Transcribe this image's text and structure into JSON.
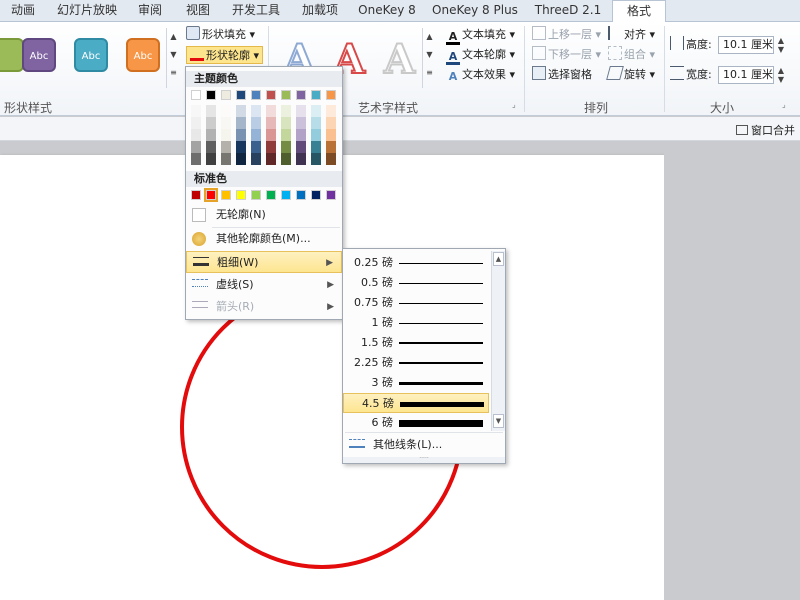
{
  "tabs": [
    {
      "label": "动画"
    },
    {
      "label": "幻灯片放映"
    },
    {
      "label": "审阅"
    },
    {
      "label": "视图"
    },
    {
      "label": "开发工具"
    },
    {
      "label": "加载项"
    },
    {
      "label": "OneKey 8"
    },
    {
      "label": "OneKey 8 Plus"
    },
    {
      "label": "ThreeD 2.1"
    },
    {
      "label": "格式"
    }
  ],
  "ribbon": {
    "shape_styles": {
      "label": "形状样式",
      "samples": [
        "Abc",
        "Abc",
        "Abc"
      ]
    },
    "shape_fill": "形状填充",
    "shape_outline": "形状轮廓",
    "wordart": {
      "label": "艺术字样式",
      "sample": "A",
      "text_fill": "文本填充",
      "text_outline": "文本轮廓",
      "text_effects": "文本效果"
    },
    "arrange": {
      "label": "排列",
      "bring_forward": "上移一层",
      "send_backward": "下移一层",
      "selection_pane": "选择窗格",
      "align": "对齐",
      "group": "组合",
      "rotate": "旋转"
    },
    "size": {
      "label": "大小",
      "height_label": "高度:",
      "height_value": "10.1 厘米",
      "width_label": "宽度:",
      "width_value": "10.1 厘米"
    }
  },
  "status": {
    "window_merge": "窗口合并"
  },
  "outline_menu": {
    "theme_colors_title": "主题颜色",
    "standard_colors_title": "标准色",
    "no_outline": "无轮廓(N)",
    "more_colors": "其他轮廓颜色(M)...",
    "weight": "粗细(W)",
    "dashes": "虚线(S)",
    "arrows": "箭头(R)",
    "theme_top_row": [
      "#ffffff",
      "#000000",
      "#eeece1",
      "#1f497d",
      "#4f81bd",
      "#c0504d",
      "#9bbb59",
      "#8064a2",
      "#4bacc6",
      "#f79646"
    ],
    "standard_colors": [
      "#c00000",
      "#ff0000",
      "#ffc000",
      "#ffff00",
      "#92d050",
      "#00b050",
      "#00b0f0",
      "#0070c0",
      "#002060",
      "#7030a0"
    ],
    "selected_standard": "#ff0000"
  },
  "weight_menu": {
    "items": [
      {
        "label": "0.25 磅",
        "pt": 0.25
      },
      {
        "label": "0.5 磅",
        "pt": 0.5
      },
      {
        "label": "0.75 磅",
        "pt": 0.75
      },
      {
        "label": "1 磅",
        "pt": 1
      },
      {
        "label": "1.5 磅",
        "pt": 1.5
      },
      {
        "label": "2.25 磅",
        "pt": 2.25
      },
      {
        "label": "3 磅",
        "pt": 3
      },
      {
        "label": "4.5 磅",
        "pt": 4.5
      },
      {
        "label": "6 磅",
        "pt": 6
      }
    ],
    "selected": "4.5 磅",
    "more_lines": "其他线条(L)..."
  },
  "shape": {
    "outline_color": "#e30b0b"
  }
}
